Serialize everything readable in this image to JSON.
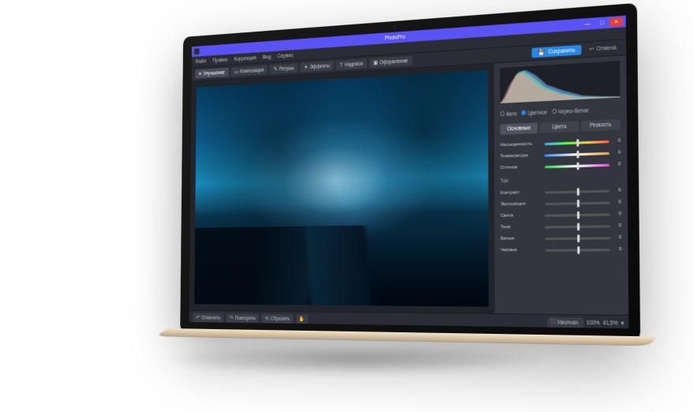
{
  "app_title": "PhotoPro",
  "window_controls": {
    "min": "—",
    "max": "□",
    "close": "×"
  },
  "menubar": [
    "Файл",
    "Правка",
    "Коррекция",
    "Вид",
    "Сервис"
  ],
  "tool_tabs": [
    {
      "label": "Улучшение",
      "active": true
    },
    {
      "label": "Композиция",
      "active": false
    },
    {
      "label": "Ретушь",
      "active": false
    },
    {
      "label": "Эффекты",
      "active": false
    },
    {
      "label": "Надписи",
      "active": false
    },
    {
      "label": "Оформление",
      "active": false
    }
  ],
  "btn_primary": "Сохранить",
  "btn_reset": "Отмена",
  "color_mode": {
    "options": [
      "Авто",
      "Цветное",
      "Черно-белое"
    ],
    "selected": 1
  },
  "subtabs": [
    "Основные",
    "Цвета",
    "Резкость"
  ],
  "subtab_active": 0,
  "sliders_color": [
    {
      "name": "Насыщенность",
      "value": 0,
      "kind": "color",
      "pos": 50
    },
    {
      "name": "Температура",
      "value": 0,
      "kind": "temp",
      "pos": 50
    },
    {
      "name": "Оттенок",
      "value": 0,
      "kind": "tint",
      "pos": 50
    }
  ],
  "section_tone": "Тон",
  "sliders_tone": [
    {
      "name": "Контраст",
      "value": 0,
      "pos": 50
    },
    {
      "name": "Экспозиция",
      "value": 0,
      "pos": 50
    },
    {
      "name": "Света",
      "value": 0,
      "pos": 50
    },
    {
      "name": "Тени",
      "value": 0,
      "pos": 50
    },
    {
      "name": "Белые",
      "value": 0,
      "pos": 50
    },
    {
      "name": "Черные",
      "value": 0,
      "pos": 50
    }
  ],
  "status_left": [
    {
      "label": "Отменить"
    },
    {
      "label": "Повторить"
    },
    {
      "label": "Сбросить"
    }
  ],
  "status_right": [
    {
      "label": "Умолчан."
    }
  ],
  "zoom_a": "100%",
  "zoom_b": "41,5%"
}
